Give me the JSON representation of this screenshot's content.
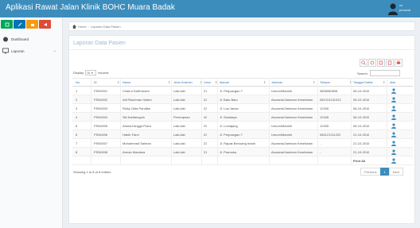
{
  "header": {
    "app_title": "Aplikasi Rawat Jalan Klinik BOHC Muara Badak",
    "user_line1": "ve",
    "user_line2": "perawat"
  },
  "colors": {
    "topbar": "#3c8dbc",
    "btn_green": "#00a65a",
    "btn_blue": "#0073b7",
    "btn_orange": "#f39c12",
    "btn_red": "#dd4b39"
  },
  "sidebar": {
    "buttons": [
      {
        "icon": "edit-icon",
        "color": "#00a65a"
      },
      {
        "icon": "pencil-icon",
        "color": "#0073b7"
      },
      {
        "icon": "folder-icon",
        "color": "#f39c12"
      },
      {
        "icon": "share-icon",
        "color": "#dd4b39"
      }
    ],
    "items": [
      {
        "label": "Dashboard",
        "icon": "dashboard-icon"
      },
      {
        "label": "Laporan",
        "icon": "monitor-icon"
      }
    ]
  },
  "breadcrumb": {
    "home": "Home",
    "current": "Laporan Data Pasien"
  },
  "panel": {
    "title": "Laporan Data Pasien"
  },
  "toolbar": {
    "icons": [
      "search-icon",
      "refresh-icon",
      "copy-icon",
      "file-icon",
      "print-icon"
    ]
  },
  "table_controls": {
    "display_label": "Display",
    "length_value": "10",
    "records_label": "records",
    "search_label": "Search:"
  },
  "table": {
    "headers": [
      "No.",
      "ID",
      "Nama",
      "Jenis Kelamin",
      "Umur",
      "Alamat",
      "Jaminan",
      "Telepon",
      "Tanggal Daftar",
      "Aksi"
    ],
    "rows": [
      [
        "1",
        "PSN0001",
        "Chairul Saifil Anam",
        "Laki-laki",
        "21",
        "Jl. Perjuangan 7",
        "Umum/Mandiri",
        "0808080808",
        "06-10-2016"
      ],
      [
        "2",
        "PSN0002",
        "Arif Rachman Hakim",
        "Laki-laki",
        "22",
        "Jl. Batu Batu",
        "Asuransi/Jaminan Kesehatan",
        "081313131312",
        "06-10-2016"
      ],
      [
        "3",
        "PSN0003",
        "Rizky Okta Pandika",
        "Laki-laki",
        "22",
        "Jl. Loa Janan",
        "Asuransi/Jaminan Kesehatan",
        "12345",
        "06-10-2016"
      ],
      [
        "4",
        "PSN0004",
        "Siti Kartiansyah",
        "Perempuan",
        "49",
        "Jl. Swadaya",
        "Asuransi/Jaminan Kesehatan",
        "12345",
        "06-10-2016"
      ],
      [
        "5",
        "PSN0005",
        "Ahmad Angga Putra",
        "Laki-laki",
        "22",
        "Jl. Lumajang",
        "Umum/Mandiri",
        "12345",
        "06-10-2016"
      ],
      [
        "6",
        "PSN0006",
        "Habib Fahri",
        "Laki-laki",
        "22",
        "Jl. Perjuangan 7",
        "Umum/Mandiri",
        "082121211222",
        "21-10-2016"
      ],
      [
        "7",
        "PSN0007",
        "Muhammad Salman",
        "Laki-laki",
        "22",
        "Jl. Rapak Benuang Indah",
        "Asuransi/Jaminan Kesehatan",
        "-",
        "21-10-2016"
      ],
      [
        "8",
        "PSN0008",
        "Arman Maulana",
        "Laki-laki",
        "21",
        "Jl. Pramuka",
        "Asuransi/Jaminan Kesehatan",
        "-",
        "21-10-2016"
      ]
    ],
    "footer_label": "Print All"
  },
  "footer": {
    "showing": "Showing 1 to 8 of 8 entries",
    "prev": "Previous",
    "page": "1",
    "next": "Next"
  }
}
